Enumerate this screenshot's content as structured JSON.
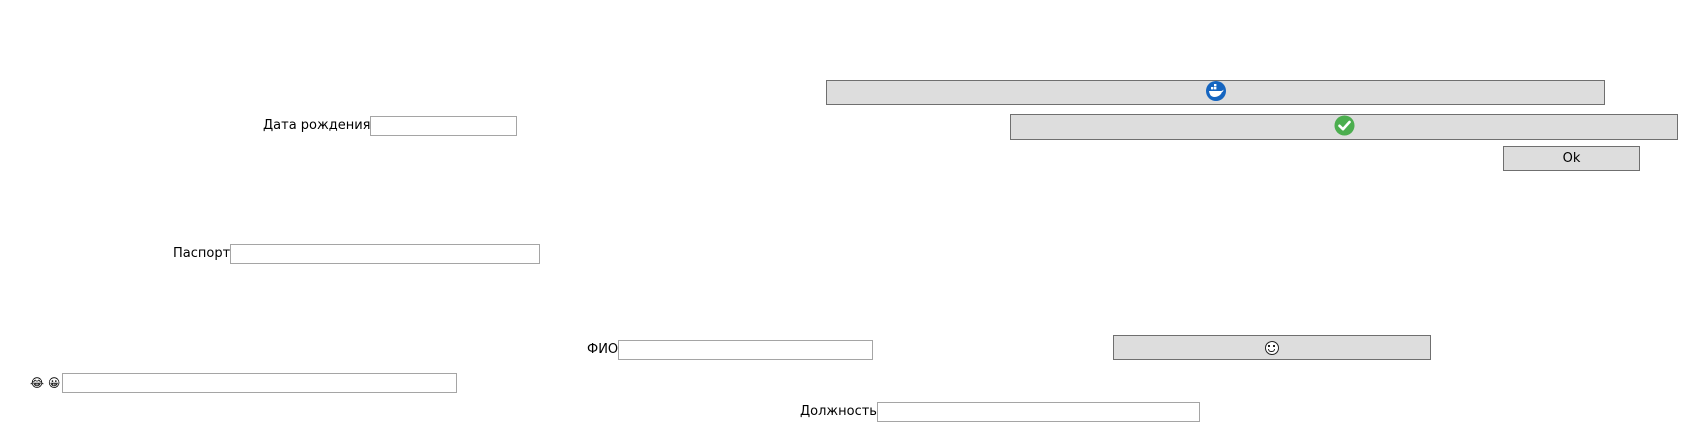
{
  "fields": {
    "birth_date": {
      "label": "Дата рождения",
      "value": ""
    },
    "passport": {
      "label": "Паспорт",
      "value": ""
    },
    "fio": {
      "label": "ФИО",
      "value": ""
    },
    "emoji_field": {
      "label": "😂 😀",
      "value": ""
    },
    "position": {
      "label": "Должность",
      "value": ""
    }
  },
  "buttons": {
    "top_icon_button": {
      "icon": "docker-whale-icon"
    },
    "check_button": {
      "icon": "green-checkmark-icon"
    },
    "ok_button": {
      "label": "Ok"
    },
    "emoji_button": {
      "icon": "laughing-face-icon"
    }
  },
  "colors": {
    "button_bg": "#dddddd",
    "button_border": "#6f6f6f",
    "input_border": "#a5a5a5",
    "check_green": "#4cae4f",
    "whale_blue": "#1565c0"
  }
}
